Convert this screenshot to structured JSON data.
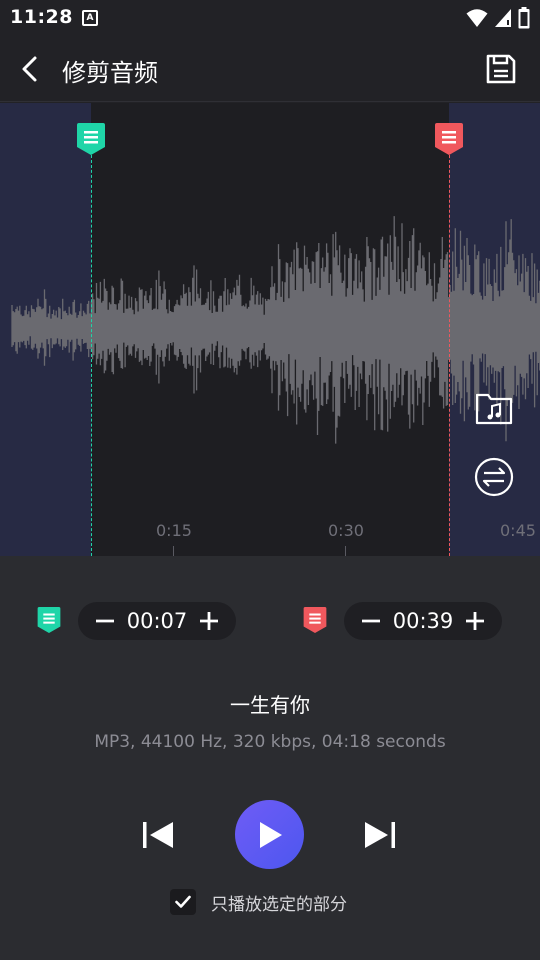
{
  "status_bar": {
    "time": "11:28",
    "notification_icon": "a-letter-icon",
    "icons": [
      "wifi-icon",
      "signal-icon",
      "battery-icon"
    ]
  },
  "app_bar": {
    "title": "修剪音频",
    "back_icon": "chevron-left-icon",
    "save_icon": "save-icon"
  },
  "waveform": {
    "ticks": [
      "0:15",
      "0:30",
      "0:45"
    ],
    "start_marker_color": "#1fd5a8",
    "end_marker_color": "#f0585d",
    "side_buttons": [
      "music-folder-icon",
      "swap-icon"
    ]
  },
  "trim": {
    "start_time": "00:07",
    "end_time": "00:39"
  },
  "song": {
    "title": "一生有你",
    "info": "MP3, 44100 Hz, 320 kbps, 04:18 seconds"
  },
  "playback": {
    "play_only_selected_label": "只播放选定的部分",
    "play_only_selected": true,
    "accent": "#5b58f2"
  }
}
